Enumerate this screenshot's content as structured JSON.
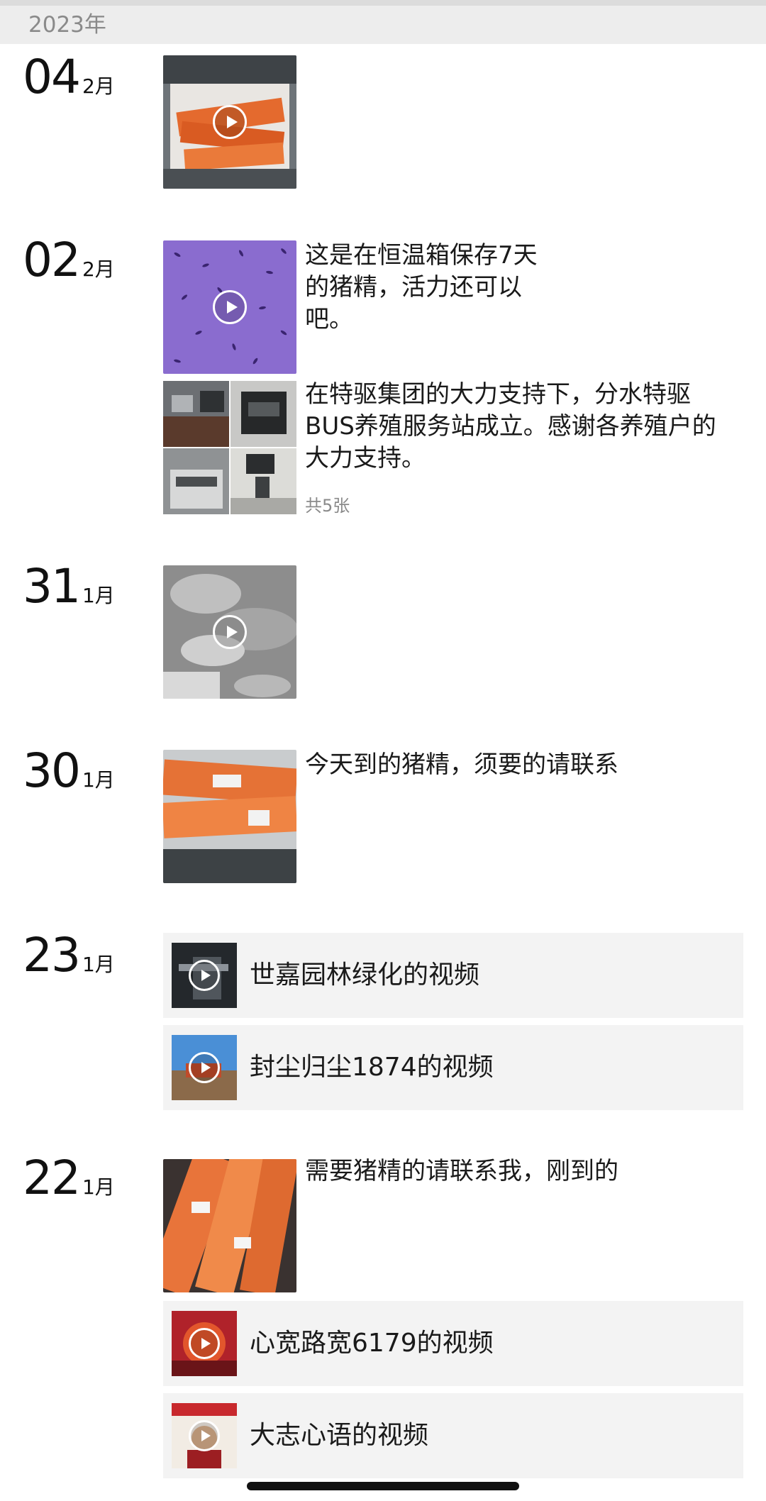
{
  "year_header": "2023年",
  "entries": [
    {
      "day": "04",
      "month": "2月"
    },
    {
      "day": "02",
      "month": "2月",
      "post1_caption": "这是在恒温箱保存7天的猪精，活力还可以吧。",
      "post2_caption": "在特驱集团的大力支持下，分水特驱BUS养殖服务站成立。感谢各养殖户的大力支持。",
      "post2_count": "共5张"
    },
    {
      "day": "31",
      "month": "1月"
    },
    {
      "day": "30",
      "month": "1月",
      "caption": "今天到的猪精，须要的请联系"
    },
    {
      "day": "23",
      "month": "1月",
      "link1_title": "世嘉园林绿化的视频",
      "link2_title": "封尘归尘1874的视频"
    },
    {
      "day": "22",
      "month": "1月",
      "caption": "需要猪精的请联系我，刚到的",
      "link1_title": "心宽路宽6179的视频",
      "link2_title": "大志心语的视频"
    }
  ]
}
